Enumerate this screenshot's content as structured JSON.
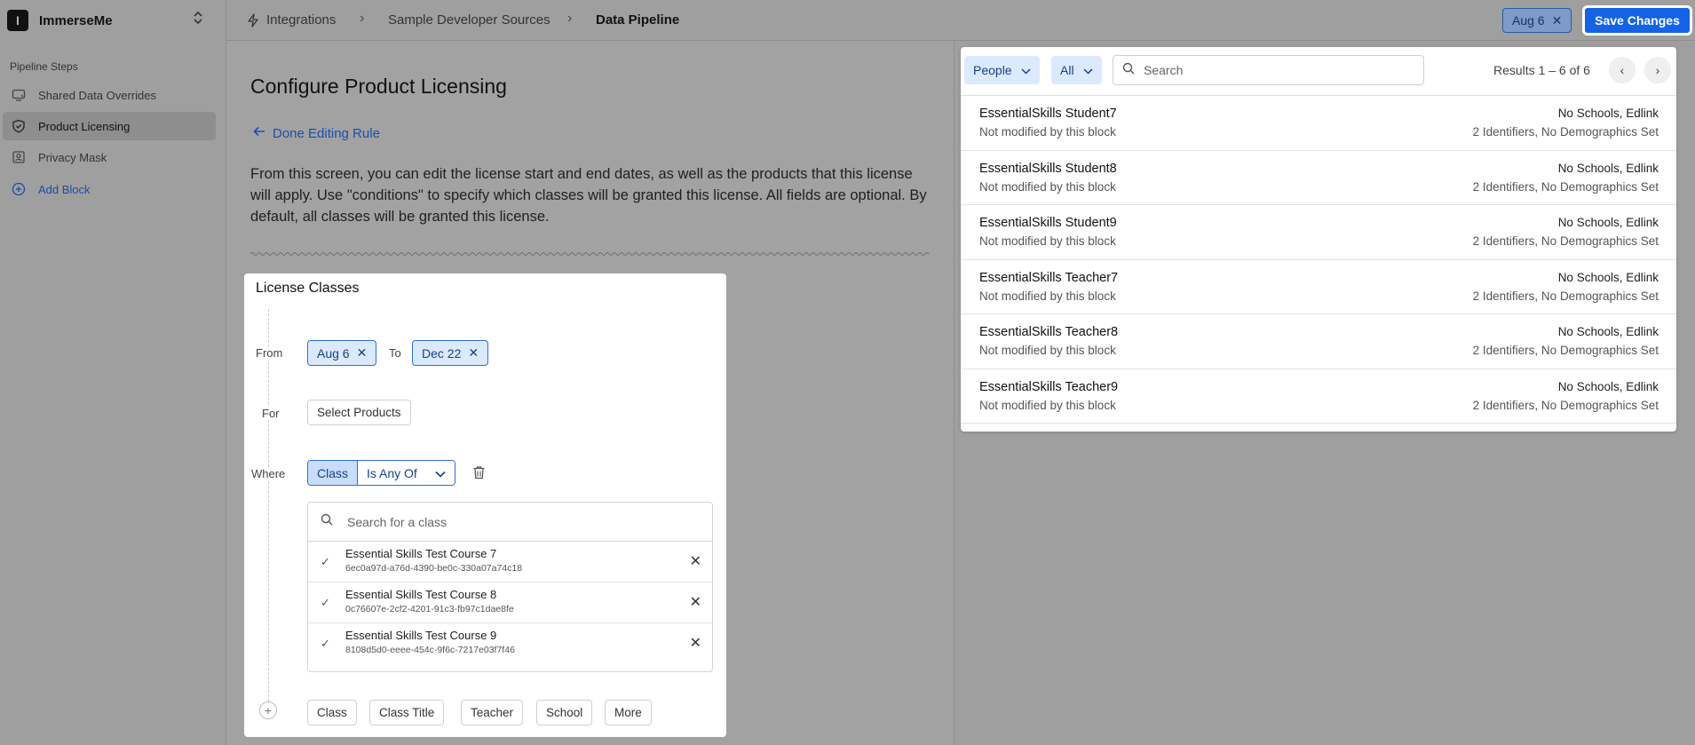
{
  "org": {
    "initial": "I",
    "name": "ImmerseMe"
  },
  "sidebar": {
    "section_title": "Pipeline Steps",
    "items": [
      {
        "label": "Shared Data Overrides",
        "icon": "overrides-icon"
      },
      {
        "label": "Product Licensing",
        "icon": "license-shield-icon",
        "active": true
      },
      {
        "label": "Privacy Mask",
        "icon": "privacy-icon"
      },
      {
        "label": "Add Block",
        "icon": "plus-circle-icon"
      }
    ]
  },
  "breadcrumb": [
    "Integrations",
    "Sample Developer Sources",
    "Data Pipeline"
  ],
  "header": {
    "date_chip": "Aug 6",
    "save_label": "Save Changes"
  },
  "main": {
    "title": "Configure Product Licensing",
    "back_link": "Done Editing Rule",
    "description": "From this screen, you can edit the license start and end dates, as well as the products that this license will apply. Use \"conditions\" to specify which classes will be granted this license. All fields are optional. By default, all classes will be granted this license."
  },
  "card": {
    "title": "License Classes",
    "from_label": "From",
    "from_value": "Aug 6",
    "to_label": "To",
    "to_value": "Dec 22",
    "for_label": "For",
    "select_products": "Select Products",
    "where_label": "Where",
    "condition_field": "Class",
    "condition_op": "Is Any Of",
    "class_search_placeholder": "Search for a class",
    "classes": [
      {
        "title": "Essential Skills Test Course 7",
        "id": "6ec0a97d-a76d-4390-be0c-330a07a74c18"
      },
      {
        "title": "Essential Skills Test Course 8",
        "id": "0c76607e-2cf2-4201-91c3-fb97c1dae8fe"
      },
      {
        "title": "Essential Skills Test Course 9",
        "id": "8108d5d0-eeee-454c-9f6c-7217e03f7f46"
      }
    ],
    "add_filters": [
      "Class",
      "Class Title",
      "Teacher",
      "School",
      "More"
    ]
  },
  "panel": {
    "entity_dropdown": "People",
    "filter_dropdown": "All",
    "search_placeholder": "Search",
    "results_text": "Results 1 – 6 of 6",
    "rows": [
      {
        "name": "EssentialSkills Student7",
        "status": "Not modified by this block",
        "schools": "No Schools, Edlink",
        "meta": "2 Identifiers, No Demographics Set"
      },
      {
        "name": "EssentialSkills Student8",
        "status": "Not modified by this block",
        "schools": "No Schools, Edlink",
        "meta": "2 Identifiers, No Demographics Set"
      },
      {
        "name": "EssentialSkills Student9",
        "status": "Not modified by this block",
        "schools": "No Schools, Edlink",
        "meta": "2 Identifiers, No Demographics Set"
      },
      {
        "name": "EssentialSkills Teacher7",
        "status": "Not modified by this block",
        "schools": "No Schools, Edlink",
        "meta": "2 Identifiers, No Demographics Set"
      },
      {
        "name": "EssentialSkills Teacher8",
        "status": "Not modified by this block",
        "schools": "No Schools, Edlink",
        "meta": "2 Identifiers, No Demographics Set"
      },
      {
        "name": "EssentialSkills Teacher9",
        "status": "Not modified by this block",
        "schools": "No Schools, Edlink",
        "meta": "2 Identifiers, No Demographics Set"
      }
    ]
  },
  "colors": {
    "accent": "#1463e6",
    "link": "#1a4fa8",
    "chip_bg": "#dceaff"
  }
}
